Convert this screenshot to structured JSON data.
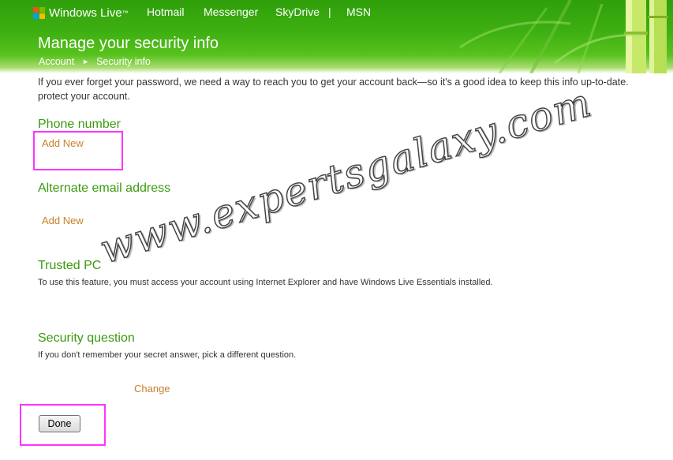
{
  "brand": {
    "name": "Windows Live",
    "tm": "™"
  },
  "topnav": {
    "hotmail": "Hotmail",
    "messenger": "Messenger",
    "skydrive": "SkyDrive",
    "divider": "|",
    "msn": "MSN"
  },
  "page": {
    "title": "Manage your security info"
  },
  "breadcrumb": {
    "account": "Account",
    "separator": "►",
    "current": "Security info"
  },
  "intro": {
    "line1": "If you ever forget your password, we need a way to reach you to get your account back—so it's a good idea to keep this info up-to-date.",
    "line2": "protect your account."
  },
  "sections": {
    "phone": {
      "heading": "Phone number",
      "action": "Add New"
    },
    "email": {
      "heading": "Alternate email address",
      "action": "Add New"
    },
    "trusted_pc": {
      "heading": "Trusted PC",
      "description": "To use this feature, you must access your account using Internet Explorer and have Windows Live Essentials installed."
    },
    "security_question": {
      "heading": "Security question",
      "description": "If you don't remember your secret answer, pick a different question.",
      "action": "Change"
    }
  },
  "done_button": "Done",
  "watermark": "www.expertsgalaxy.com",
  "colors": {
    "header_green": "#3fb012",
    "heading_green": "#3c9a10",
    "link_orange": "#c8812a",
    "highlight": "#ff33ff"
  }
}
